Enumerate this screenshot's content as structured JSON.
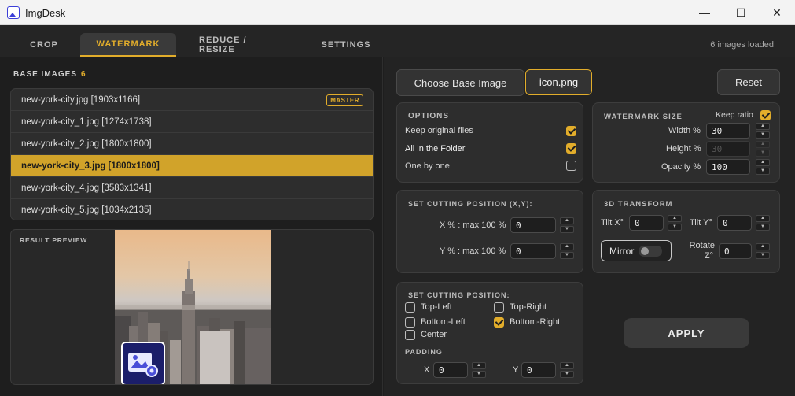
{
  "window": {
    "title": "ImgDesk",
    "minimize": "—",
    "maximize": "☐",
    "close": "✕"
  },
  "tabs": [
    {
      "label": "CROP"
    },
    {
      "label": "WATERMARK"
    },
    {
      "label": "REDUCE / RESIZE"
    },
    {
      "label": "SETTINGS"
    }
  ],
  "status": "6 images loaded",
  "base_images": {
    "title": "BASE IMAGES",
    "count": "6",
    "master_badge": "MASTER",
    "items": [
      "new-york-city.jpg [1903x1166]",
      "new-york-city_1.jpg [1274x1738]",
      "new-york-city_2.jpg [1800x1800]",
      "new-york-city_3.jpg [1800x1800]",
      "new-york-city_4.jpg [3583x1341]",
      "new-york-city_5.jpg [1034x2135]"
    ],
    "selected_index": 3
  },
  "preview": {
    "title": "RESULT PREVIEW"
  },
  "buttons": {
    "choose_base": "Choose Base Image",
    "icon_file": "icon.png",
    "reset": "Reset",
    "apply": "APPLY"
  },
  "options": {
    "title": "OPTIONS",
    "keep_original": "Keep original files",
    "all_in_folder": "All in the Folder",
    "one_by_one": "One by one"
  },
  "watermark_size": {
    "title": "WATERMARK SIZE",
    "keep_ratio": "Keep ratio",
    "width_label": "Width %",
    "width": "30",
    "height_label": "Height %",
    "height": "30",
    "opacity_label": "Opacity %",
    "opacity": "100"
  },
  "cutting_xy": {
    "title": "SET CUTTING POSITION (X,Y):",
    "x_label": "X % : max 100 %",
    "x": "0",
    "y_label": "Y % : max 100 %",
    "y": "0"
  },
  "transform": {
    "title": "3D TRANSFORM",
    "tilt_x_label": "Tilt X°",
    "tilt_x": "0",
    "tilt_y_label": "Tilt Y°",
    "tilt_y": "0",
    "mirror": "Mirror",
    "rotate_label_1": "Rotate",
    "rotate_label_2": "Z°",
    "rotate": "0"
  },
  "cutting_pos": {
    "title": "SET CUTTING POSITION:",
    "top_left": "Top-Left",
    "top_right": "Top-Right",
    "bottom_left": "Bottom-Left",
    "bottom_right": "Bottom-Right",
    "center": "Center"
  },
  "padding": {
    "title": "PADDING",
    "x_label": "X",
    "x": "0",
    "y_label": "Y",
    "y": "0"
  },
  "colors": {
    "accent": "#e2ad2b",
    "bg": "#1e1e1e",
    "panel": "#2d2d2d"
  }
}
